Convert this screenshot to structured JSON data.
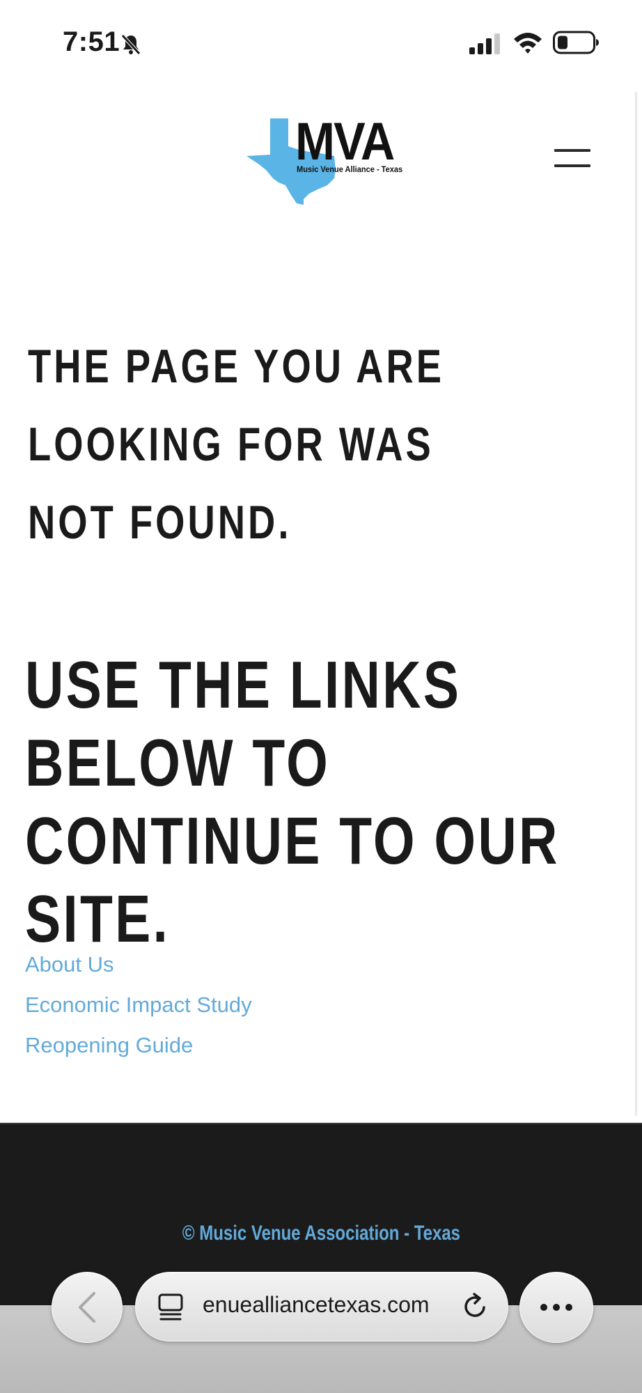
{
  "status_bar": {
    "time": "7:51",
    "icons": [
      "bell-slash-icon",
      "cellular-signal-icon",
      "wifi-icon",
      "battery-icon"
    ]
  },
  "header": {
    "logo": {
      "title": "MVA",
      "subtitle": "Music Venue Alliance - Texas",
      "icon": "texas-map-icon",
      "colors": {
        "map": "#5ab4e5",
        "text": "#111111"
      }
    },
    "menu_icon": "hamburger-menu-icon"
  },
  "main": {
    "heading_not_found": "THE PAGE YOU ARE LOOKING FOR WAS NOT FOUND.",
    "heading_continue": "USE THE LINKS BELOW TO CONTINUE TO OUR SITE.",
    "links": [
      {
        "label": "About Us"
      },
      {
        "label": "Economic Impact Study"
      },
      {
        "label": "Reopening Guide"
      }
    ]
  },
  "footer": {
    "copyright": "© Music Venue Association - Texas"
  },
  "browser": {
    "url": "enuealliancetexas.com",
    "icons": [
      "back-icon",
      "tabs-icon",
      "reload-icon",
      "more-icon"
    ]
  },
  "colors": {
    "link": "#62aad9",
    "footer_bg": "#1b1b1c",
    "heading": "#1a1a1a"
  }
}
